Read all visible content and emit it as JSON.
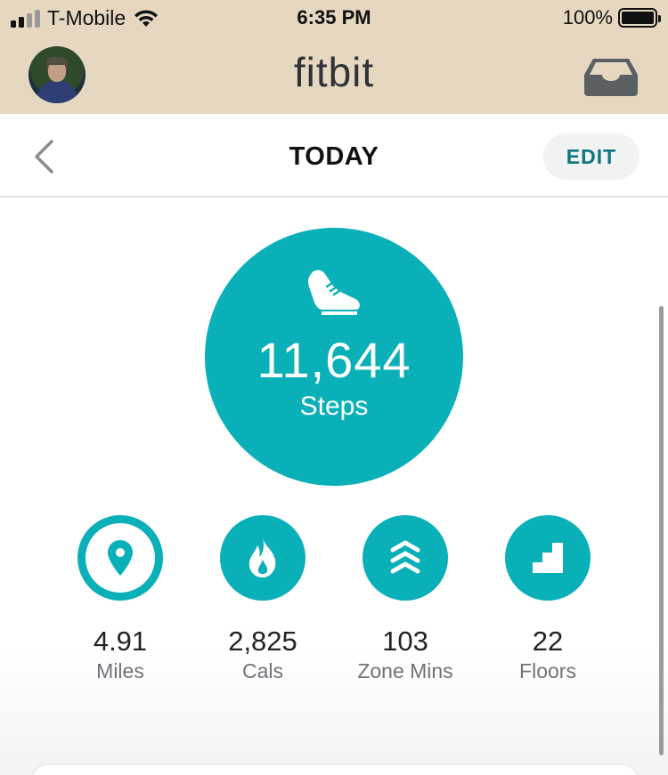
{
  "status_bar": {
    "carrier": "T-Mobile",
    "time": "6:35 PM",
    "battery": "100%"
  },
  "header": {
    "brand": "fitbit",
    "avatar_icon": "profile-avatar",
    "inbox_icon": "inbox-icon"
  },
  "subheader": {
    "title": "TODAY",
    "edit_label": "EDIT",
    "back_icon": "chevron-left-icon"
  },
  "steps": {
    "value": "11,644",
    "label": "Steps",
    "icon": "shoe-icon"
  },
  "stats": [
    {
      "value": "4.91",
      "label": "Miles",
      "icon": "location-pin-icon"
    },
    {
      "value": "2,825",
      "label": "Cals",
      "icon": "flame-icon"
    },
    {
      "value": "103",
      "label": "Zone Mins",
      "icon": "chevrons-up-icon"
    },
    {
      "value": "22",
      "label": "Floors",
      "icon": "stairs-icon"
    }
  ],
  "colors": {
    "accent": "#0ab0b8",
    "header_bg": "#e6d8c0",
    "edit_text": "#0d7680"
  }
}
